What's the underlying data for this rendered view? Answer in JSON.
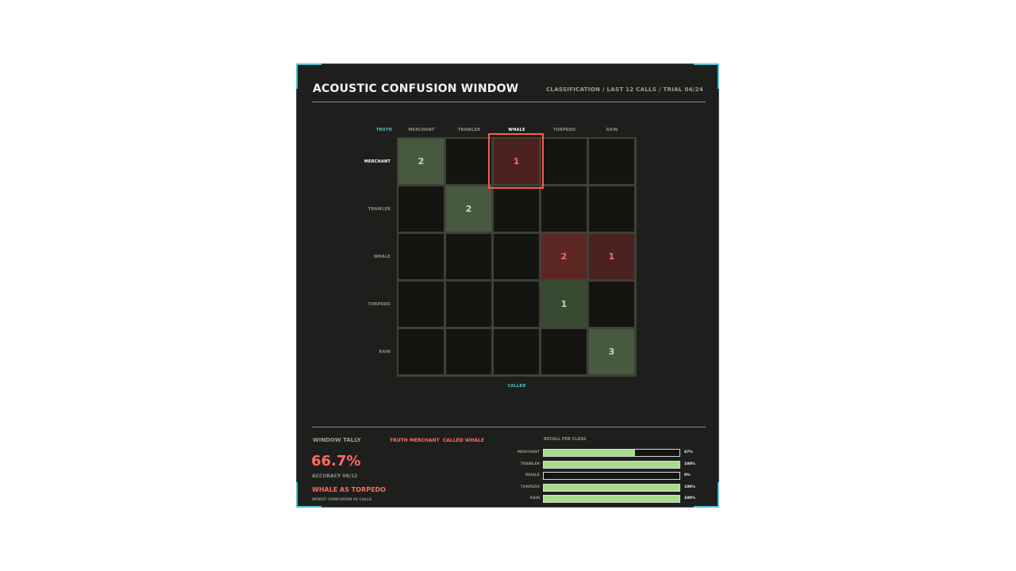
{
  "panel": {
    "title": "ACOUSTIC CONFUSION WINDOW",
    "subtitle": "CLASSIFICATION / LAST 12 CALLS / TRIAL 04/24"
  },
  "matrix": {
    "truth_label": "TRUTH",
    "called_label": "CALLED",
    "columns": [
      "MERCHANT",
      "TRAWLER",
      "WHALE",
      "TORPEDO",
      "RAIN"
    ],
    "rows": [
      "MERCHANT",
      "TRAWLER",
      "WHALE",
      "TORPEDO",
      "RAIN"
    ],
    "counts": [
      [
        2,
        0,
        1,
        0,
        0
      ],
      [
        0,
        2,
        0,
        0,
        0
      ],
      [
        0,
        0,
        0,
        2,
        1
      ],
      [
        0,
        0,
        0,
        1,
        0
      ],
      [
        0,
        0,
        0,
        0,
        3
      ]
    ],
    "selected": {
      "row": 0,
      "col": 2
    }
  },
  "tally": {
    "heading": "WINDOW TALLY",
    "selection_truth": "TRUTH MERCHANT",
    "selection_called": "CALLED WHALE",
    "accuracy_pct": "66.7%",
    "accuracy_label": "ACCURACY 08/12",
    "worst": "WHALE AS TORPEDO",
    "worst_sub": "WORST CONFUSION 02 CALLS"
  },
  "recall": {
    "heading": "RECALL PER CLASS",
    "items": [
      {
        "name": "MERCHANT",
        "pct": "67%",
        "value": 0.67
      },
      {
        "name": "TRAWLER",
        "pct": "100%",
        "value": 1.0
      },
      {
        "name": "WHALE",
        "pct": "0%",
        "value": 0.0
      },
      {
        "name": "TORPEDO",
        "pct": "100%",
        "value": 1.0
      },
      {
        "name": "RAIN",
        "pct": "100%",
        "value": 1.0
      }
    ]
  },
  "colors": {
    "accent": "#55c1d0",
    "correct": "#b6e59e",
    "error": "#ff6a60",
    "bar": "#a6dd8a"
  }
}
